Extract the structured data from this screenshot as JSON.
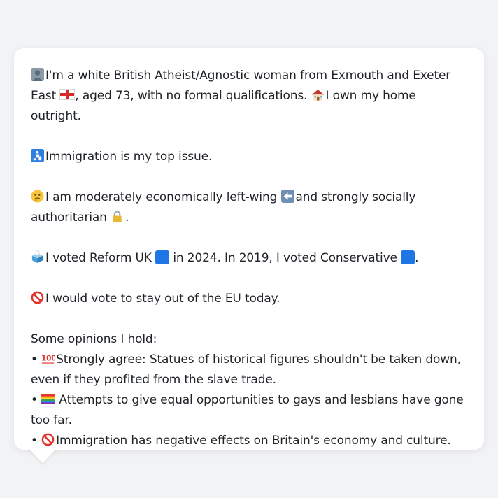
{
  "profile": {
    "intro_line1": "I'm a white British Atheist/Agnostic woman from Exmouth and Exeter",
    "intro_line2a": "East",
    "intro_line2b": ", aged 73, with no formal qualifications.",
    "intro_line2c": "I own my home outright.",
    "top_issue": "Immigration is my top issue.",
    "ideology_a": "I am moderately economically left-wing",
    "ideology_b": "and strongly socially",
    "ideology_c": "authoritarian",
    "ideology_d": ".",
    "vote_a": "I voted Reform UK",
    "vote_b": "in 2024. In 2019, I voted Conservative",
    "vote_c": ".",
    "eu": "I would vote to stay out of the EU today.",
    "opinions_heading": "Some opinions I hold:",
    "bullet": "•",
    "opinion1_a": "Strongly agree: Statues of historical figures shouldn't be taken down,",
    "opinion1_b": "even if they profited from the slave trade.",
    "opinion2_a": "Attempts to give equal opportunities to gays and lesbians have gone",
    "opinion2_b": "too far.",
    "opinion3": "Immigration has negative effects on Britain's economy and culture."
  },
  "icons": {
    "person": "person-icon",
    "flag": "england-flag-icon",
    "house": "house-icon",
    "issue": "immigration-icon",
    "thinking": "thinking-face-icon",
    "left_arrow": "left-arrow-icon",
    "lock": "lock-icon",
    "ballot": "ballot-box-icon",
    "party_square": "blue-square-icon",
    "prohibited": "prohibited-icon",
    "hundred": "hundred-points-icon",
    "rainbow_flag": "rainbow-flag-icon"
  },
  "colors": {
    "background": "#f2f3f5",
    "bubble": "#ffffff",
    "text": "#1f2328",
    "party_blue": "#1e76e6",
    "prohibited_red": "#e0312b"
  }
}
